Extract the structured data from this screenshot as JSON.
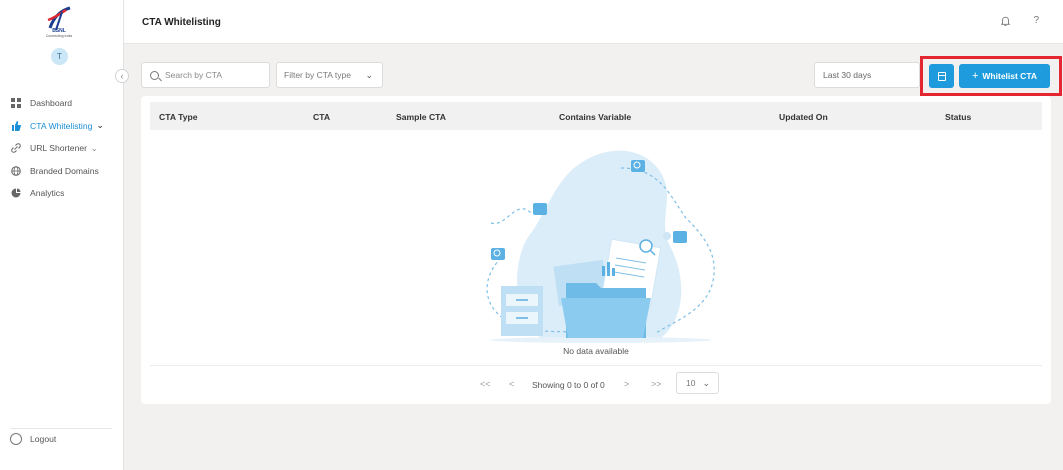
{
  "sidebar": {
    "logo": {
      "text": "BSNL",
      "tagline": "Connecting India"
    },
    "avatar_initial": "T",
    "items": [
      {
        "label": "Dashboard",
        "icon": "grid-icon"
      },
      {
        "label": "CTA Whitelisting",
        "icon": "thumbs-up-icon",
        "active": true
      },
      {
        "label": "URL Shortener",
        "icon": "link-icon"
      },
      {
        "label": "Branded Domains",
        "icon": "globe-icon"
      },
      {
        "label": "Analytics",
        "icon": "pie-chart-icon"
      }
    ],
    "logout_label": "Logout"
  },
  "header": {
    "title": "CTA Whitelisting",
    "help_label": "?"
  },
  "toolbar": {
    "search_placeholder": "Search by CTA",
    "filter_label": "Filter by CTA type",
    "date_range": "Last 30 days",
    "whitelist_button": "Whitelist CTA"
  },
  "table": {
    "columns": [
      "CTA Type",
      "CTA",
      "Sample CTA",
      "Contains Variable",
      "Updated On",
      "Status"
    ],
    "rows": [],
    "empty_message": "No data available"
  },
  "pagination": {
    "first": "<<",
    "prev": "<",
    "info": "Showing 0 to 0 of 0",
    "next": ">",
    "last": ">>",
    "page_size": "10"
  },
  "colors": {
    "accent": "#1d9bdc",
    "highlight_border": "#e3262f",
    "background": "#f3f1ef"
  }
}
